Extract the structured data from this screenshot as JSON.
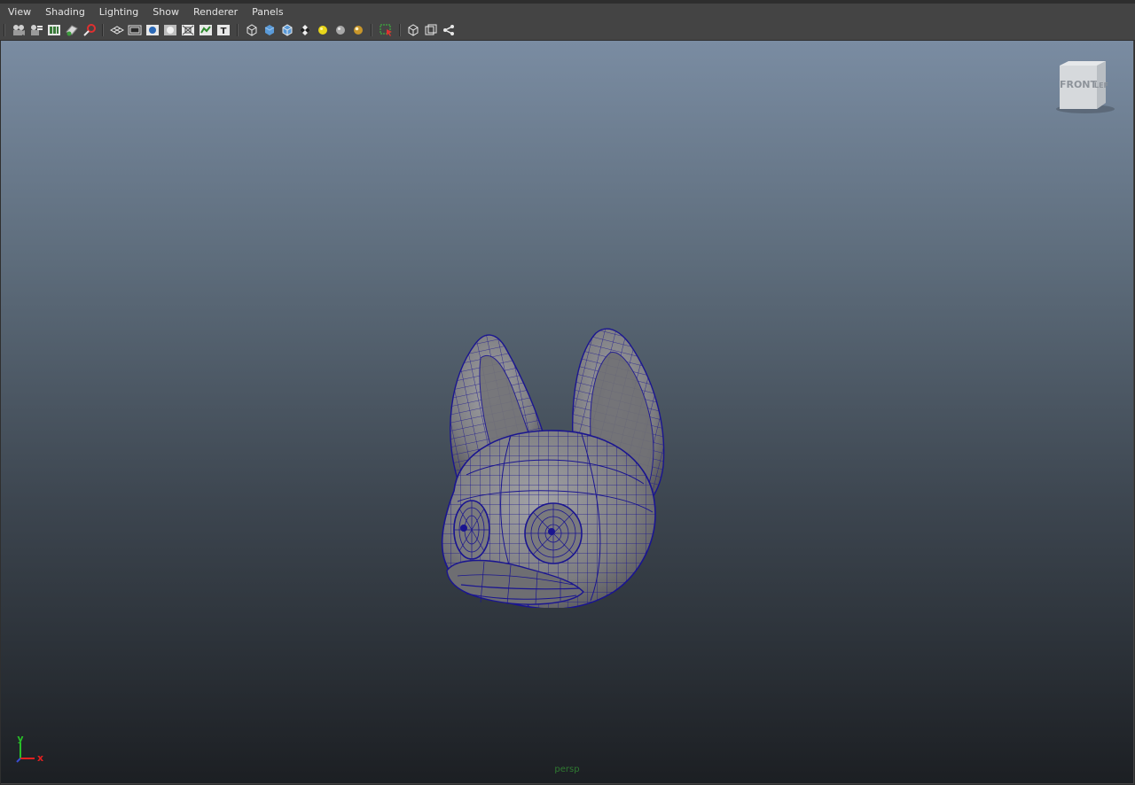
{
  "menubar": {
    "items": [
      "View",
      "Shading",
      "Lighting",
      "Show",
      "Renderer",
      "Panels"
    ]
  },
  "toolbar": {
    "icons": [
      "select-camera-icon",
      "camera-attributes-icon",
      "bookmarks-icon",
      "image-plane-icon",
      "2d-pan-zoom-icon",
      "grid-icon",
      "film-gate-icon",
      "resolution-gate-icon",
      "gate-mask-icon",
      "field-chart-icon",
      "safe-action-icon",
      "safe-title-icon",
      "wireframe-icon",
      "smooth-shade-icon",
      "wireframe-on-shaded-icon",
      "textured-icon",
      "default-lighting-icon",
      "shadows-icon",
      "hardware-render-icon",
      "isolate-select-icon",
      "xray-icon",
      "xray-joints-icon",
      "xray-components-icon"
    ]
  },
  "viewport": {
    "viewcube": {
      "face_front": "FRONT",
      "face_side": "LEF"
    },
    "axis": {
      "y_label": "y",
      "x_label": "x"
    },
    "camera_name": "persp"
  },
  "colors": {
    "wire": "#1a1590",
    "mesh": "#86868a",
    "axis_y": "#28c028",
    "axis_x": "#e02020",
    "camera_label": "#2f7a31"
  }
}
